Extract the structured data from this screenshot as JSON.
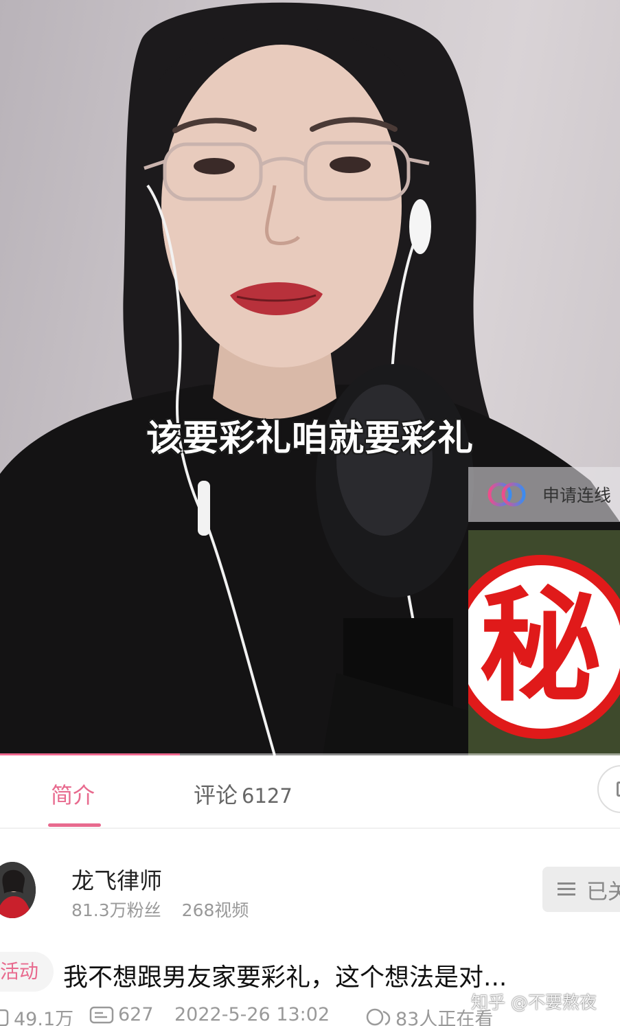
{
  "video": {
    "subtitle": "该要彩礼咱就要彩礼",
    "apply_connect_label": "申请连线",
    "secret_badge_text": "秘",
    "progress": 0.29
  },
  "tabs": {
    "intro_label": "简介",
    "comments_label": "评论",
    "comments_count": "6127"
  },
  "author": {
    "name": "龙飞律师",
    "followers": "81.3万粉丝",
    "videos": "268视频",
    "follow_label": "已关"
  },
  "title": {
    "tag": "活动",
    "text": "我不想跟男友家要彩礼，这个想法是对..."
  },
  "meta": {
    "plays": "49.1万",
    "danmaku": "627",
    "date": "2022-5-26 13:02",
    "watching": "83人正在看"
  },
  "watermark": "知乎 @不要熬夜",
  "colors": {
    "accent": "#e86a8e",
    "badge_red": "#e01a1a"
  }
}
